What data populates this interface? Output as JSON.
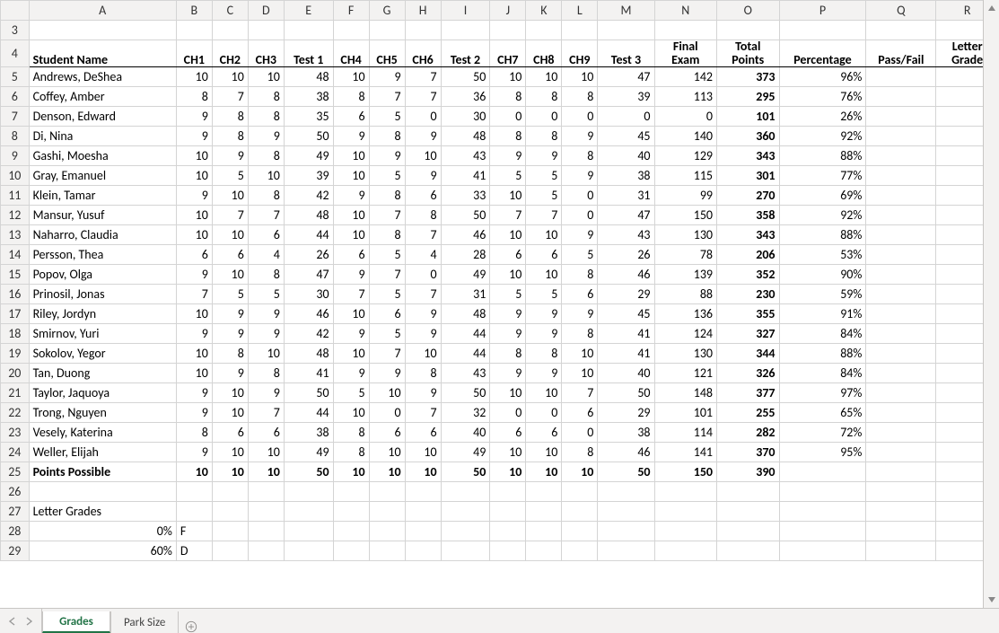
{
  "columns": [
    "A",
    "B",
    "C",
    "D",
    "E",
    "F",
    "G",
    "H",
    "I",
    "J",
    "K",
    "L",
    "M",
    "N",
    "O",
    "P",
    "Q",
    "R"
  ],
  "first_row_number": 3,
  "headers": [
    "Student Name",
    "CH1",
    "CH2",
    "CH3",
    "Test 1",
    "CH4",
    "CH5",
    "CH6",
    "Test 2",
    "CH7",
    "CH8",
    "CH9",
    "Test 3",
    "Final Exam",
    "Total Points",
    "Percentage",
    "Pass/Fail",
    "Letter Grade"
  ],
  "students": [
    {
      "name": "Andrews, DeShea",
      "ch1": 10,
      "ch2": 10,
      "ch3": 10,
      "t1": 48,
      "ch4": 10,
      "ch5": 9,
      "ch6": 7,
      "t2": 50,
      "ch7": 10,
      "ch8": 10,
      "ch9": 10,
      "t3": 47,
      "final": 142,
      "total": 373,
      "pct": "96%"
    },
    {
      "name": "Coffey, Amber",
      "ch1": 8,
      "ch2": 7,
      "ch3": 8,
      "t1": 38,
      "ch4": 8,
      "ch5": 7,
      "ch6": 7,
      "t2": 36,
      "ch7": 8,
      "ch8": 8,
      "ch9": 8,
      "t3": 39,
      "final": 113,
      "total": 295,
      "pct": "76%"
    },
    {
      "name": "Denson, Edward",
      "ch1": 9,
      "ch2": 8,
      "ch3": 8,
      "t1": 35,
      "ch4": 6,
      "ch5": 5,
      "ch6": 0,
      "t2": 30,
      "ch7": 0,
      "ch8": 0,
      "ch9": 0,
      "t3": 0,
      "final": 0,
      "total": 101,
      "pct": "26%"
    },
    {
      "name": "Di, Nina",
      "ch1": 9,
      "ch2": 8,
      "ch3": 9,
      "t1": 50,
      "ch4": 9,
      "ch5": 8,
      "ch6": 9,
      "t2": 48,
      "ch7": 8,
      "ch8": 8,
      "ch9": 9,
      "t3": 45,
      "final": 140,
      "total": 360,
      "pct": "92%"
    },
    {
      "name": "Gashi, Moesha",
      "ch1": 10,
      "ch2": 9,
      "ch3": 8,
      "t1": 49,
      "ch4": 10,
      "ch5": 9,
      "ch6": 10,
      "t2": 43,
      "ch7": 9,
      "ch8": 9,
      "ch9": 8,
      "t3": 40,
      "final": 129,
      "total": 343,
      "pct": "88%"
    },
    {
      "name": "Gray, Emanuel",
      "ch1": 10,
      "ch2": 5,
      "ch3": 10,
      "t1": 39,
      "ch4": 10,
      "ch5": 5,
      "ch6": 9,
      "t2": 41,
      "ch7": 5,
      "ch8": 5,
      "ch9": 9,
      "t3": 38,
      "final": 115,
      "total": 301,
      "pct": "77%"
    },
    {
      "name": "Klein, Tamar",
      "ch1": 9,
      "ch2": 10,
      "ch3": 8,
      "t1": 42,
      "ch4": 9,
      "ch5": 8,
      "ch6": 6,
      "t2": 33,
      "ch7": 10,
      "ch8": 5,
      "ch9": 0,
      "t3": 31,
      "final": 99,
      "total": 270,
      "pct": "69%"
    },
    {
      "name": "Mansur, Yusuf",
      "ch1": 10,
      "ch2": 7,
      "ch3": 7,
      "t1": 48,
      "ch4": 10,
      "ch5": 7,
      "ch6": 8,
      "t2": 50,
      "ch7": 7,
      "ch8": 7,
      "ch9": 0,
      "t3": 47,
      "final": 150,
      "total": 358,
      "pct": "92%"
    },
    {
      "name": "Naharro, Claudia",
      "ch1": 10,
      "ch2": 10,
      "ch3": 6,
      "t1": 44,
      "ch4": 10,
      "ch5": 8,
      "ch6": 7,
      "t2": 46,
      "ch7": 10,
      "ch8": 10,
      "ch9": 9,
      "t3": 43,
      "final": 130,
      "total": 343,
      "pct": "88%"
    },
    {
      "name": "Persson, Thea",
      "ch1": 6,
      "ch2": 6,
      "ch3": 4,
      "t1": 26,
      "ch4": 6,
      "ch5": 5,
      "ch6": 4,
      "t2": 28,
      "ch7": 6,
      "ch8": 6,
      "ch9": 5,
      "t3": 26,
      "final": 78,
      "total": 206,
      "pct": "53%"
    },
    {
      "name": "Popov, Olga",
      "ch1": 9,
      "ch2": 10,
      "ch3": 8,
      "t1": 47,
      "ch4": 9,
      "ch5": 7,
      "ch6": 0,
      "t2": 49,
      "ch7": 10,
      "ch8": 10,
      "ch9": 8,
      "t3": 46,
      "final": 139,
      "total": 352,
      "pct": "90%"
    },
    {
      "name": "Prinosil, Jonas",
      "ch1": 7,
      "ch2": 5,
      "ch3": 5,
      "t1": 30,
      "ch4": 7,
      "ch5": 5,
      "ch6": 7,
      "t2": 31,
      "ch7": 5,
      "ch8": 5,
      "ch9": 6,
      "t3": 29,
      "final": 88,
      "total": 230,
      "pct": "59%"
    },
    {
      "name": "Riley, Jordyn",
      "ch1": 10,
      "ch2": 9,
      "ch3": 9,
      "t1": 46,
      "ch4": 10,
      "ch5": 6,
      "ch6": 9,
      "t2": 48,
      "ch7": 9,
      "ch8": 9,
      "ch9": 9,
      "t3": 45,
      "final": 136,
      "total": 355,
      "pct": "91%"
    },
    {
      "name": "Smirnov, Yuri",
      "ch1": 9,
      "ch2": 9,
      "ch3": 9,
      "t1": 42,
      "ch4": 9,
      "ch5": 5,
      "ch6": 9,
      "t2": 44,
      "ch7": 9,
      "ch8": 9,
      "ch9": 8,
      "t3": 41,
      "final": 124,
      "total": 327,
      "pct": "84%"
    },
    {
      "name": "Sokolov, Yegor",
      "ch1": 10,
      "ch2": 8,
      "ch3": 10,
      "t1": 48,
      "ch4": 10,
      "ch5": 7,
      "ch6": 10,
      "t2": 44,
      "ch7": 8,
      "ch8": 8,
      "ch9": 10,
      "t3": 41,
      "final": 130,
      "total": 344,
      "pct": "88%"
    },
    {
      "name": "Tan, Duong",
      "ch1": 10,
      "ch2": 9,
      "ch3": 8,
      "t1": 41,
      "ch4": 9,
      "ch5": 9,
      "ch6": 8,
      "t2": 43,
      "ch7": 9,
      "ch8": 9,
      "ch9": 10,
      "t3": 40,
      "final": 121,
      "total": 326,
      "pct": "84%"
    },
    {
      "name": "Taylor, Jaquoya",
      "ch1": 9,
      "ch2": 10,
      "ch3": 9,
      "t1": 50,
      "ch4": 5,
      "ch5": 10,
      "ch6": 9,
      "t2": 50,
      "ch7": 10,
      "ch8": 10,
      "ch9": 7,
      "t3": 50,
      "final": 148,
      "total": 377,
      "pct": "97%"
    },
    {
      "name": "Trong, Nguyen",
      "ch1": 9,
      "ch2": 10,
      "ch3": 7,
      "t1": 44,
      "ch4": 10,
      "ch5": 0,
      "ch6": 7,
      "t2": 32,
      "ch7": 0,
      "ch8": 0,
      "ch9": 6,
      "t3": 29,
      "final": 101,
      "total": 255,
      "pct": "65%"
    },
    {
      "name": "Vesely, Katerina",
      "ch1": 8,
      "ch2": 6,
      "ch3": 6,
      "t1": 38,
      "ch4": 8,
      "ch5": 6,
      "ch6": 6,
      "t2": 40,
      "ch7": 6,
      "ch8": 6,
      "ch9": 0,
      "t3": 38,
      "final": 114,
      "total": 282,
      "pct": "72%"
    },
    {
      "name": "Weller, Elijah",
      "ch1": 9,
      "ch2": 10,
      "ch3": 10,
      "t1": 49,
      "ch4": 8,
      "ch5": 10,
      "ch6": 10,
      "t2": 49,
      "ch7": 10,
      "ch8": 10,
      "ch9": 8,
      "t3": 46,
      "final": 141,
      "total": 370,
      "pct": "95%"
    }
  ],
  "points_row": {
    "label": "Points Possible",
    "ch1": 10,
    "ch2": 10,
    "ch3": 10,
    "t1": 50,
    "ch4": 10,
    "ch5": 10,
    "ch6": 10,
    "t2": 50,
    "ch7": 10,
    "ch8": 10,
    "ch9": 10,
    "t3": 50,
    "final": 150,
    "total": 390
  },
  "letter_grades": {
    "title": "Letter Grades",
    "rows": [
      {
        "pct": "0%",
        "grade": "F"
      },
      {
        "pct": "60%",
        "grade": "D"
      }
    ]
  },
  "tabs": {
    "active": "Grades",
    "others": [
      "Park Size"
    ]
  }
}
